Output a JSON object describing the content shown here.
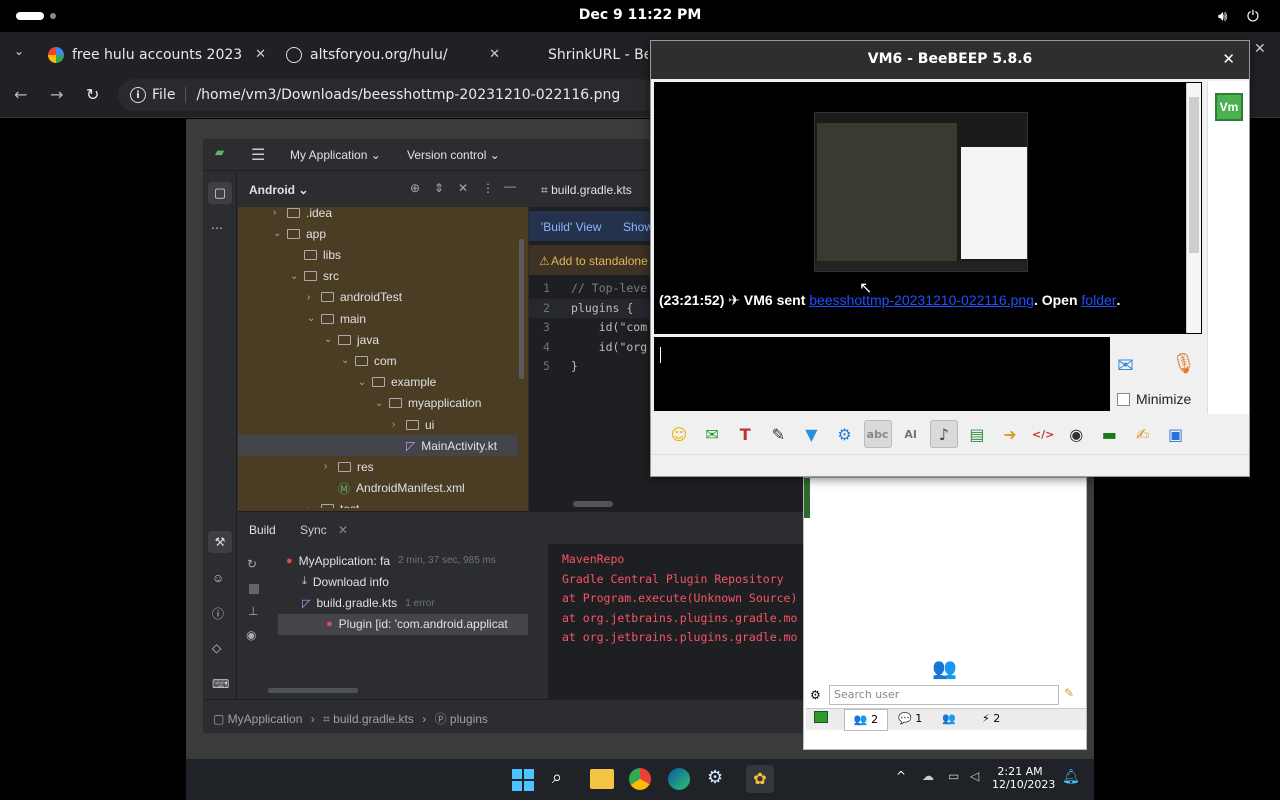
{
  "topbar": {
    "clock": "Dec 9  11:22 PM",
    "icons": [
      "activities-indicator",
      "volume-icon",
      "power-icon"
    ]
  },
  "browser": {
    "tabs": [
      {
        "title": "free hulu accounts 2023",
        "favicon": "google-icon"
      },
      {
        "title": "altsforyou.org/hulu/",
        "favicon": "globe-icon"
      },
      {
        "title": "ShrinkURL - Be",
        "favicon": "none"
      }
    ],
    "url_chip": "File",
    "url": "/home/vm3/Downloads/beesshottmp-20231210-022116.png"
  },
  "android_studio": {
    "project_name": "My Application",
    "vcs": "Version control",
    "panel_view": "Android",
    "tree": [
      {
        "label": ".idea",
        "indent": 1,
        "chev": "›"
      },
      {
        "label": "app",
        "indent": 1,
        "chev": "⌄"
      },
      {
        "label": "libs",
        "indent": 2,
        "chev": ""
      },
      {
        "label": "src",
        "indent": 2,
        "chev": "⌄"
      },
      {
        "label": "androidTest",
        "indent": 3,
        "chev": "›"
      },
      {
        "label": "main",
        "indent": 3,
        "chev": "⌄"
      },
      {
        "label": "java",
        "indent": 4,
        "chev": "⌄"
      },
      {
        "label": "com",
        "indent": 5,
        "chev": "⌄"
      },
      {
        "label": "example",
        "indent": 6,
        "chev": "⌄"
      },
      {
        "label": "myapplication",
        "indent": 7,
        "chev": "⌄"
      },
      {
        "label": "ui",
        "indent": 8,
        "chev": "›"
      },
      {
        "label": "MainActivity.kt",
        "indent": 8,
        "chev": ""
      },
      {
        "label": "res",
        "indent": 4,
        "chev": "›"
      },
      {
        "label": "AndroidManifest.xml",
        "indent": 4,
        "chev": ""
      },
      {
        "label": "test",
        "indent": 3,
        "chev": "›"
      }
    ],
    "editor_tab": "build.gradle.kts",
    "build_view_label": "'Build' View",
    "build_view_show": "Show",
    "banner": "Add to standalone",
    "code_lines": [
      {
        "n": "1",
        "text": "// Top-leve"
      },
      {
        "n": "2",
        "text": "plugins {"
      },
      {
        "n": "3",
        "text": "    id(\"com"
      },
      {
        "n": "4",
        "text": "    id(\"org"
      },
      {
        "n": "5",
        "text": "}"
      }
    ],
    "bottom_tabs": [
      "Build",
      "Sync"
    ],
    "build_tree": [
      {
        "label": "MyApplication: fa",
        "meta": "2 min, 37 sec, 985 ms"
      },
      {
        "label": "Download info",
        "meta": ""
      },
      {
        "label": "build.gradle.kts",
        "meta": "1 error"
      },
      {
        "label": "Plugin [id: 'com.android.applicat",
        "meta": ""
      }
    ],
    "console": [
      "MavenRepo",
      "Gradle Central Plugin Repository",
      "at Program.execute(Unknown Source)",
      "at org.jetbrains.plugins.gradle.mo",
      "at org.jetbrains.plugins.gradle.mo"
    ],
    "breadcrumb": [
      "MyApplication",
      "build.gradle.kts",
      "plugins"
    ]
  },
  "windows_taskbar": {
    "time": "2:21 AM",
    "date": "12/10/2023"
  },
  "beebeep_userlist": {
    "search_placeholder": "Search user",
    "tabs": [
      {
        "icon": "screen-icon",
        "count": ""
      },
      {
        "icon": "users-icon",
        "count": "2"
      },
      {
        "icon": "chat-icon",
        "count": "1"
      },
      {
        "icon": "groups-icon",
        "count": ""
      },
      {
        "icon": "share-icon",
        "count": "2"
      }
    ]
  },
  "beebeep_chat": {
    "title": "VM6 - BeeBEEP 5.8.6",
    "avatar_label": "Vm",
    "message_time": "(23:21:52)",
    "message_sender": "VM6 sent",
    "message_link": "beesshottmp-20231210-022116.png",
    "message_open": ". Open",
    "message_folder": "folder",
    "message_end": ".",
    "minimize_label": "Minimize",
    "toolbar_icons": [
      "emoticon-icon",
      "bee-icon",
      "font-icon",
      "color-icon",
      "filter-icon",
      "settings-icon",
      "spellcheck-icon",
      "ai-icon",
      "note-icon",
      "file-icon",
      "folder-send-icon",
      "code-icon",
      "screenshot-icon",
      "terminal-icon",
      "save-chat-icon",
      "save-icon"
    ]
  }
}
